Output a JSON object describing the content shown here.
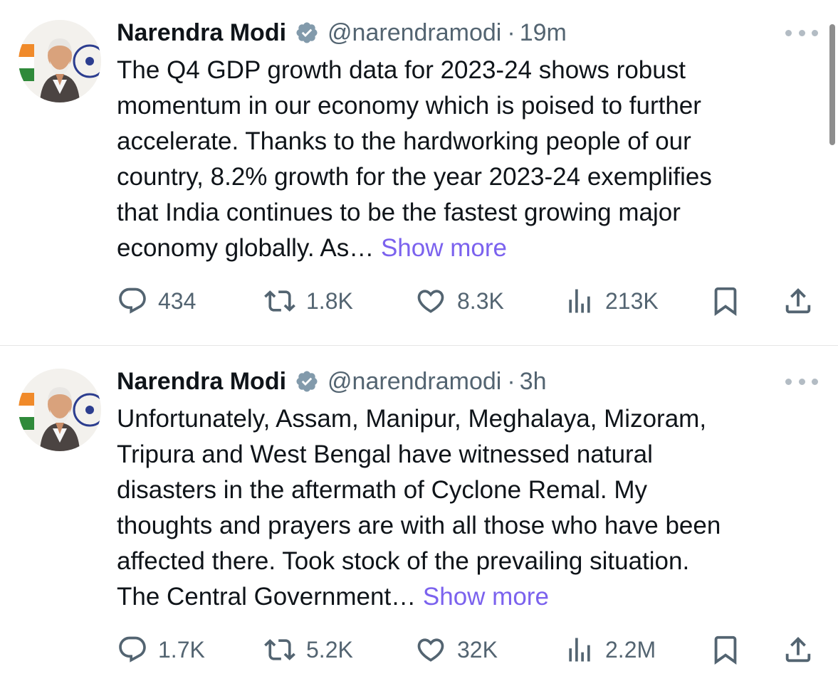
{
  "tweets": [
    {
      "name": "Narendra Modi",
      "handle": "@narendramodi",
      "dot": "·",
      "time": "19m",
      "lines": [
        "The Q4 GDP growth data for 2023-24 shows robust",
        "momentum in our economy which is poised to further",
        "accelerate. Thanks to the hardworking people of our",
        "country, 8.2% growth for the year 2023-24 exemplifies",
        "that India continues to be the fastest growing major"
      ],
      "last_line": "economy globally. As…",
      "show_more": "Show more",
      "stats": {
        "replies": "434",
        "reposts": "1.8K",
        "likes": "8.3K",
        "views": "213K"
      }
    },
    {
      "name": "Narendra Modi",
      "handle": "@narendramodi",
      "dot": "·",
      "time": "3h",
      "lines": [
        "Unfortunately, Assam, Manipur, Meghalaya, Mizoram,",
        "Tripura and West Bengal have witnessed natural",
        "disasters in the aftermath of Cyclone Remal. My",
        "thoughts and prayers are with all those who have been",
        "affected there. Took stock of the prevailing situation."
      ],
      "last_line": "The Central Government…",
      "show_more": "Show more",
      "stats": {
        "replies": "1.7K",
        "reposts": "5.2K",
        "likes": "32K",
        "views": "2.2M"
      }
    }
  ],
  "icons": {
    "verified": "verified-badge-icon",
    "more": "more-options-icon",
    "reply": "reply-icon",
    "repost": "repost-icon",
    "like": "like-icon",
    "views": "views-icon",
    "bookmark": "bookmark-icon",
    "share": "share-icon"
  },
  "colors": {
    "text": "#0f1419",
    "secondary": "#536471",
    "link": "#7b62ee",
    "verified": "#829aab"
  }
}
